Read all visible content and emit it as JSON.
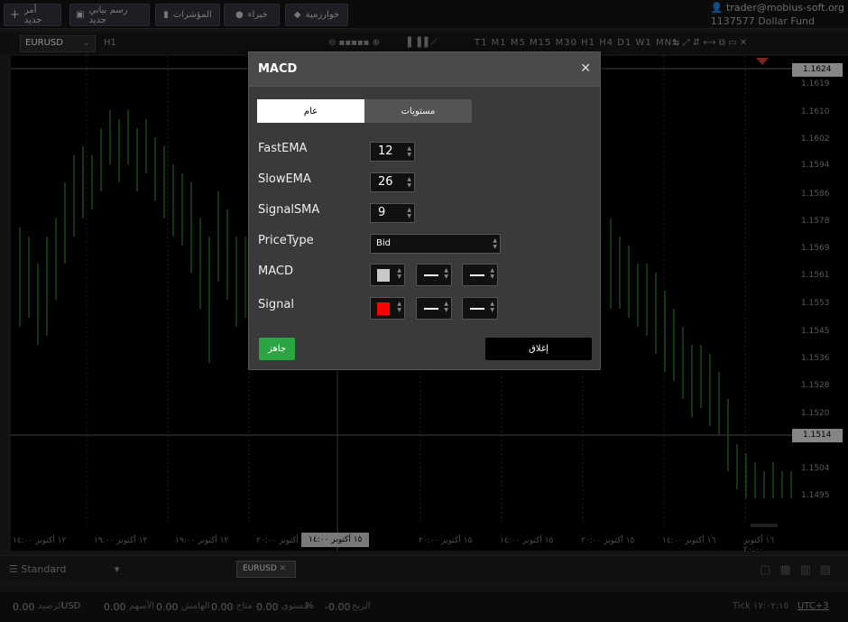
{
  "toolbar": {
    "buttons": [
      {
        "label": "أمر جديد",
        "icon": "plus-icon"
      },
      {
        "label": "رسم بياني جديد",
        "icon": "chart-icon"
      },
      {
        "label": "المؤشرات",
        "icon": "indicators-icon"
      },
      {
        "label": "خبراء",
        "icon": "experts-icon"
      },
      {
        "label": "خوارزمية",
        "icon": "algorithm-icon"
      }
    ]
  },
  "account": {
    "email": "trader@mobius-soft.org",
    "id_line": "1137577  Dollar Fund"
  },
  "chart_toolbar": {
    "symbol": "EURUSD",
    "timeframe": "H1",
    "periods": [
      "T1",
      "M1",
      "M5",
      "M15",
      "M30",
      "H1",
      "H4",
      "D1",
      "W1",
      "MN1"
    ]
  },
  "price_axis": {
    "labels": [
      "1.1619",
      "1.1610",
      "1.1602",
      "1.1594",
      "1.1586",
      "1.1578",
      "1.1569",
      "1.1561",
      "1.1553",
      "1.1545",
      "1.1536",
      "1.1528",
      "1.1520",
      "1.1512",
      "1.1504",
      "1.1495"
    ],
    "current_tag": "1.1624",
    "crosshair_tag": "1.1514"
  },
  "time_axis": {
    "labels": [
      "١٢ أكتوبر ١٤:٠٠",
      "١٢ أكتوبر ١٩:٠٠",
      "١٢ أكتوبر ١٩:٠٠",
      "١٢ أكتوبر ٢٠:٠٠",
      "١٥ أكتوبر ١٤:٠٠",
      "١٥ أكتوبر ٢٠:٠٠",
      "١٥ أكتوبر ١٤:٠٠",
      "١٥ أكتوبر ٢٠:٠٠",
      "١٦ أكتوبر ١٤:٠٠",
      "١٦ أكتوبر ٢٠:٠٠"
    ],
    "highlight": "١٥ أكتوبر ١٤:٠٠"
  },
  "bottom": {
    "preset": "Standard",
    "tab": "EURUSD"
  },
  "status": {
    "balance": "0.00",
    "currency": "USD",
    "equity": "0.00",
    "margin": "0.00",
    "free": "0.00",
    "pct": "%",
    "profit": "-0.00",
    "labels": [
      "الرصيد",
      "الأسهم",
      "الهامش",
      "متاح",
      "مستوى",
      "الربح"
    ],
    "tick_label": "Tick",
    "time": "١٧:٠٢:١٥",
    "tz": "UTC+3"
  },
  "dialog": {
    "title": "MACD",
    "tabs": [
      {
        "label": "عام",
        "active": true
      },
      {
        "label": "مستويات",
        "active": false
      }
    ],
    "fields": [
      {
        "label": "FastEMA",
        "value": "12"
      },
      {
        "label": "SlowEMA",
        "value": "26"
      },
      {
        "label": "SignalSMA",
        "value": "9"
      }
    ],
    "price_type": {
      "label": "PriceType",
      "value": "Bid"
    },
    "macd": {
      "label": "MACD",
      "color": "#c8c8c8"
    },
    "signal": {
      "label": "Signal",
      "color": "#ff0000"
    },
    "ok_label": "جاهز",
    "close_label": "إغلاق"
  }
}
